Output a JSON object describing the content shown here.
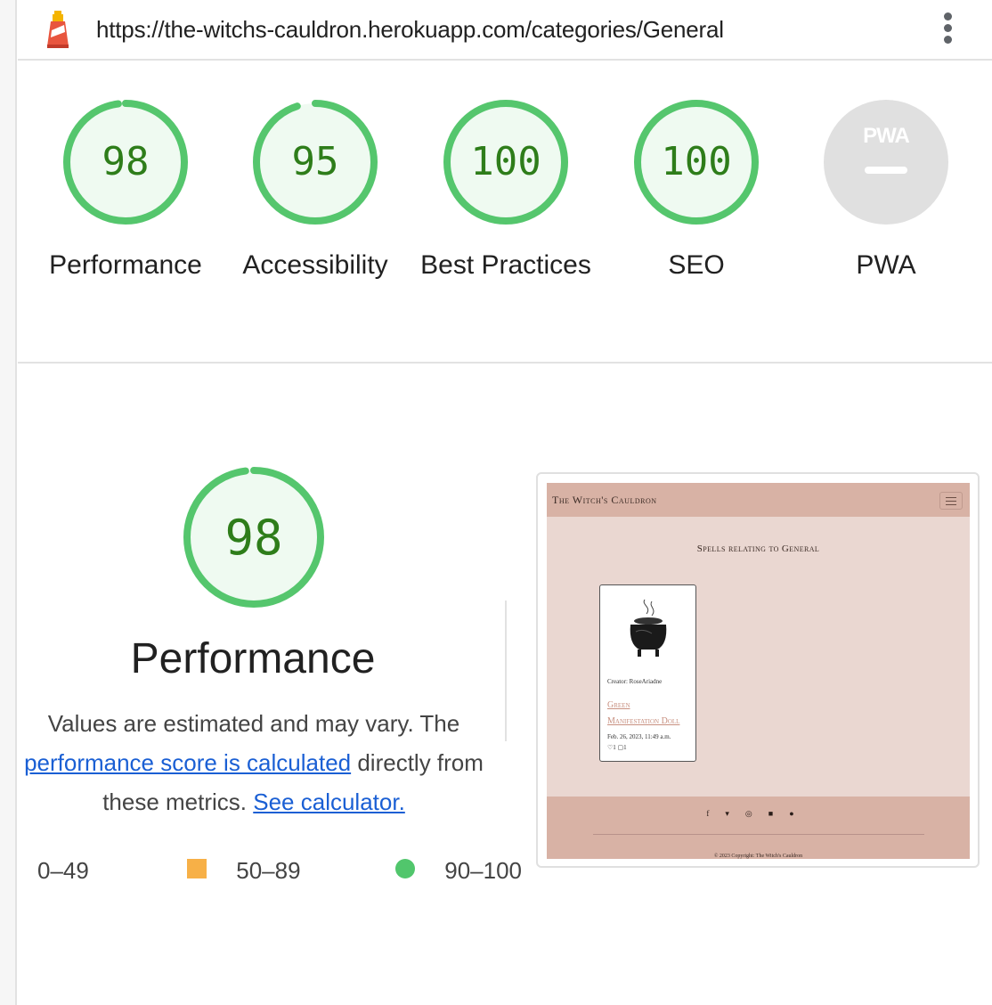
{
  "browser": {
    "url": "https://the-witchs-cauldron.herokuapp.com/categories/General"
  },
  "gauges": [
    {
      "score": "98",
      "label": "Performance"
    },
    {
      "score": "95",
      "label": "Accessibility"
    },
    {
      "score": "100",
      "label": "Best Practices"
    },
    {
      "score": "100",
      "label": "SEO"
    },
    {
      "label": "PWA",
      "badge_text": "PWA"
    }
  ],
  "performance": {
    "score": "98",
    "title": "Performance",
    "desc_prefix": "Values are estimated and may vary. The ",
    "desc_link": "performance score is calculated",
    "desc_middle": " directly from these metrics. ",
    "calculator_link": "See calculator."
  },
  "legend": {
    "fail": "0–49",
    "average": "50–89",
    "pass": "90–100"
  },
  "colors": {
    "pass": "#0cce6b",
    "average": "#ffa400",
    "fail": "#ff4e42",
    "pass_text": "#008800"
  },
  "screenshot": {
    "brand": "The Witch's Cauldron",
    "heading": "Spells relating to General",
    "card": {
      "creator": "Creator: RoseAriadne",
      "title_line1": "Green",
      "title_line2": "Manifestation Doll",
      "date": "Feb. 26, 2023, 11:49 a.m.",
      "likes": "1",
      "comments": "1"
    },
    "social_icons": [
      "facebook-icon",
      "twitter-icon",
      "instagram-icon",
      "linkedin-icon",
      "github-icon"
    ],
    "copyright": "© 2023 Copyright: The Witch's Cauldron"
  }
}
